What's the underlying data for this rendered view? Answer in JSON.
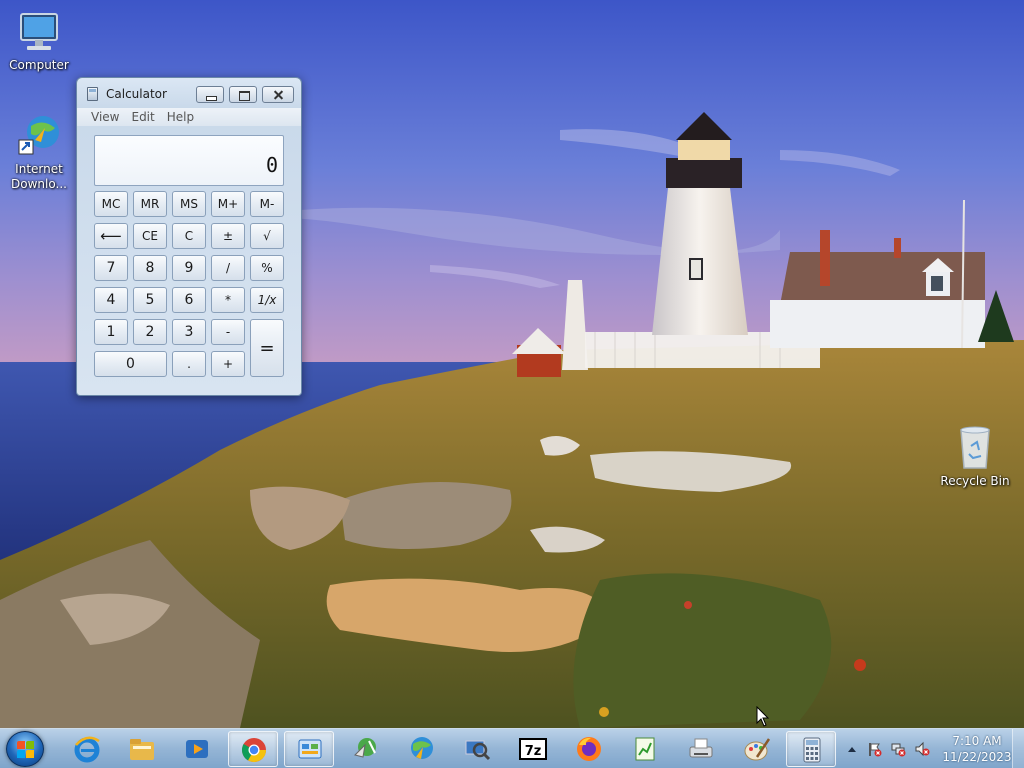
{
  "desktop": {
    "icons": [
      {
        "label": "Computer",
        "icon": "computer-icon"
      },
      {
        "label": "Internet Downlo...",
        "icon": "internet-download-manager-icon"
      },
      {
        "label": "Recycle Bin",
        "icon": "recycle-bin-icon"
      }
    ]
  },
  "calculator": {
    "title": "Calculator",
    "menu": [
      "View",
      "Edit",
      "Help"
    ],
    "display": "0",
    "keys": {
      "mc": "MC",
      "mr": "MR",
      "ms": "MS",
      "mplus": "M+",
      "mminus": "M-",
      "back": "⟵",
      "ce": "CE",
      "c": "C",
      "plusminus": "±",
      "sqrt": "√",
      "d7": "7",
      "d8": "8",
      "d9": "9",
      "div": "/",
      "pct": "%",
      "d4": "4",
      "d5": "5",
      "d6": "6",
      "mul": "*",
      "recip": "1/x",
      "d1": "1",
      "d2": "2",
      "d3": "3",
      "sub": "-",
      "eq": "=",
      "d0": "0",
      "dot": ".",
      "add": "+"
    }
  },
  "taskbar": {
    "pinned": [
      "internet-explorer-icon",
      "file-explorer-icon",
      "media-player-icon",
      "chrome-icon",
      "control-panel-icon",
      "network-tool-icon",
      "internet-download-manager-icon",
      "search-computer-icon",
      "7zip-icon",
      "firefox-icon",
      "notepad-chart-icon",
      "fax-printer-icon",
      "paint-icon",
      "calculator-icon"
    ],
    "active": [
      "chrome-icon",
      "control-panel-icon",
      "calculator-icon"
    ],
    "clock": {
      "time": "7:10 AM",
      "date": "11/22/2023"
    }
  }
}
